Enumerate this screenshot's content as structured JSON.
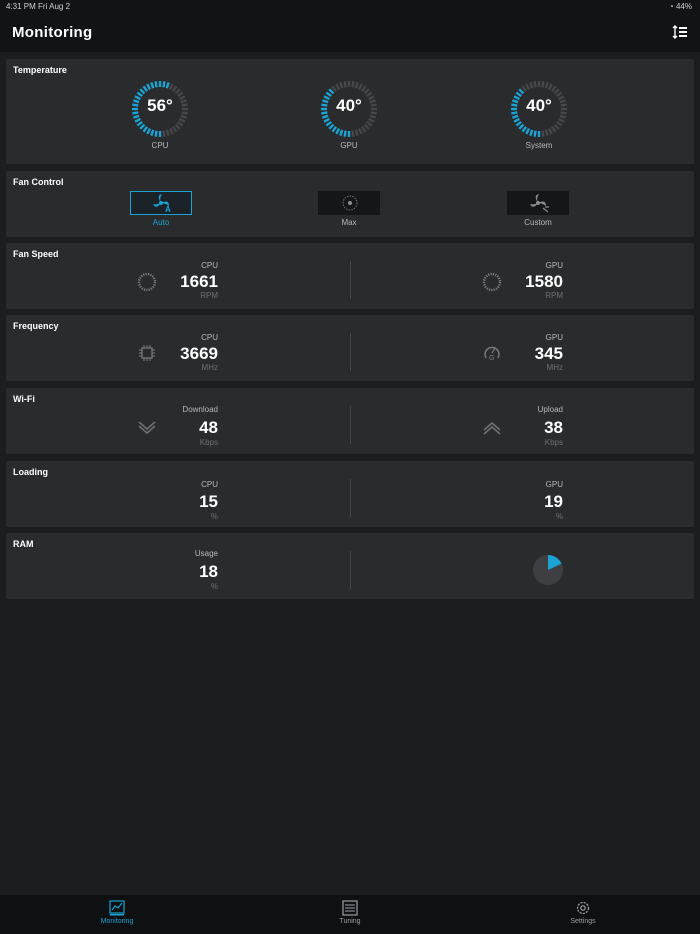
{
  "status_bar": {
    "time_date": "4:31 PM   Fri Aug 2",
    "battery": "44%"
  },
  "header": {
    "title": "Monitoring",
    "sort_icon": "sort-icon"
  },
  "temperature": {
    "title": "Temperature",
    "gauges": [
      {
        "label": "CPU",
        "value": "56°",
        "level": 0.56
      },
      {
        "label": "GPU",
        "value": "40°",
        "level": 0.4
      },
      {
        "label": "System",
        "value": "40°",
        "level": 0.4
      }
    ],
    "accent": "#1aa3d4"
  },
  "fan_control": {
    "title": "Fan Control",
    "modes": [
      {
        "label": "Auto",
        "icon": "fan-auto-icon",
        "active": true
      },
      {
        "label": "Max",
        "icon": "fan-max-icon",
        "active": false
      },
      {
        "label": "Custom",
        "icon": "fan-custom-icon",
        "active": false
      }
    ]
  },
  "fan_speed": {
    "title": "Fan Speed",
    "items": [
      {
        "label": "CPU",
        "value": "1661",
        "unit": "RPM",
        "icon": "fan-icon"
      },
      {
        "label": "GPU",
        "value": "1580",
        "unit": "RPM",
        "icon": "fan-icon"
      }
    ]
  },
  "frequency": {
    "title": "Frequency",
    "items": [
      {
        "label": "CPU",
        "value": "3669",
        "unit": "MHz",
        "icon": "cpu-chip-icon"
      },
      {
        "label": "GPU",
        "value": "345",
        "unit": "MHz",
        "icon": "gpu-gauge-icon"
      }
    ]
  },
  "wifi": {
    "title": "Wi-Fi",
    "items": [
      {
        "label": "Download",
        "value": "48",
        "unit": "Kbps",
        "icon": "download-chevron-icon"
      },
      {
        "label": "Upload",
        "value": "38",
        "unit": "Kbps",
        "icon": "upload-chevron-icon"
      }
    ]
  },
  "loading": {
    "title": "Loading",
    "items": [
      {
        "label": "CPU",
        "value": "15",
        "unit": "%"
      },
      {
        "label": "GPU",
        "value": "19",
        "unit": "%"
      }
    ]
  },
  "ram": {
    "title": "RAM",
    "usage": {
      "label": "Usage",
      "value": "18",
      "unit": "%"
    },
    "pie_fraction": 0.18
  },
  "bottom_nav": [
    {
      "label": "Monitoring",
      "icon": "monitoring-chart-icon",
      "active": true
    },
    {
      "label": "Tuning",
      "icon": "tuning-panel-icon",
      "active": false
    },
    {
      "label": "Settings",
      "icon": "settings-gear-icon",
      "active": false
    }
  ]
}
